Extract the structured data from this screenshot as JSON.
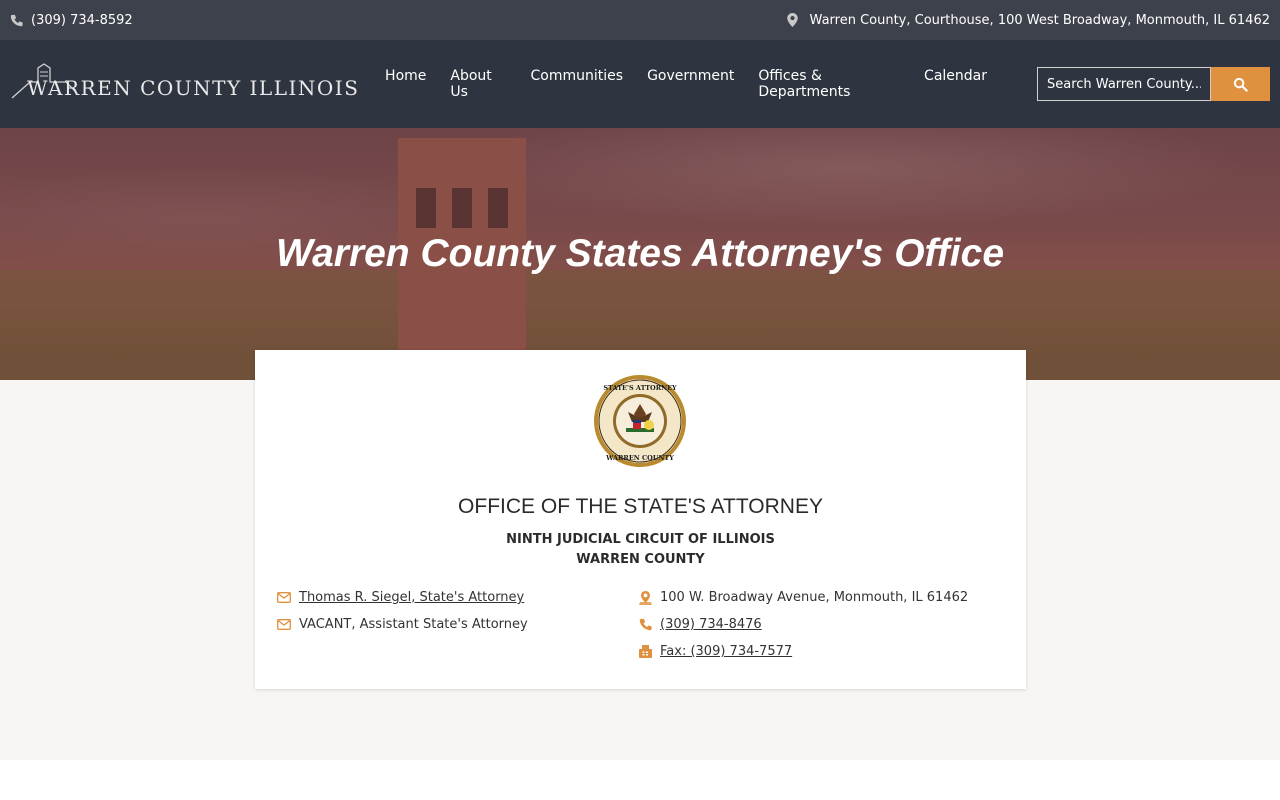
{
  "topbar": {
    "phone": "(309) 734-8592",
    "address": "Warren County, Courthouse, 100 West Broadway, Monmouth, IL 61462"
  },
  "header": {
    "logo_text": "WARREN COUNTY ILLINOIS",
    "nav": [
      "Home",
      "About Us",
      "Communities",
      "Government",
      "Offices & Departments",
      "Calendar"
    ],
    "search": {
      "placeholder": "Search Warren County..."
    }
  },
  "hero": {
    "title": "Warren County States Attorney's Office"
  },
  "card": {
    "title": "OFFICE OF THE STATE'S ATTORNEY",
    "subtitle1": "NINTH JUDICIAL CIRCUIT OF ILLINOIS",
    "subtitle2": "WARREN COUNTY",
    "seal": {
      "top_text": "STATE'S ATTORNEY",
      "bottom_text": "WARREN COUNTY"
    },
    "contacts_left": [
      {
        "icon": "envelope-icon",
        "text": "Thomas R. Siegel, State's Attorney",
        "link": true
      },
      {
        "icon": "envelope-icon",
        "text": "VACANT, Assistant State's Attorney",
        "link": false
      }
    ],
    "contacts_right": [
      {
        "icon": "map-pin-icon",
        "text": "100 W. Broadway Avenue, Monmouth, IL 61462",
        "link": false
      },
      {
        "icon": "phone-icon",
        "text": "(309) 734-8476",
        "link": true
      },
      {
        "icon": "fax-icon",
        "text": "Fax: (309) 734-7577",
        "link": true
      }
    ]
  },
  "colors": {
    "accent": "#e0913f",
    "topbar": "#3d414b",
    "header": "#2f3540",
    "content_bg": "#f8f6f3"
  }
}
